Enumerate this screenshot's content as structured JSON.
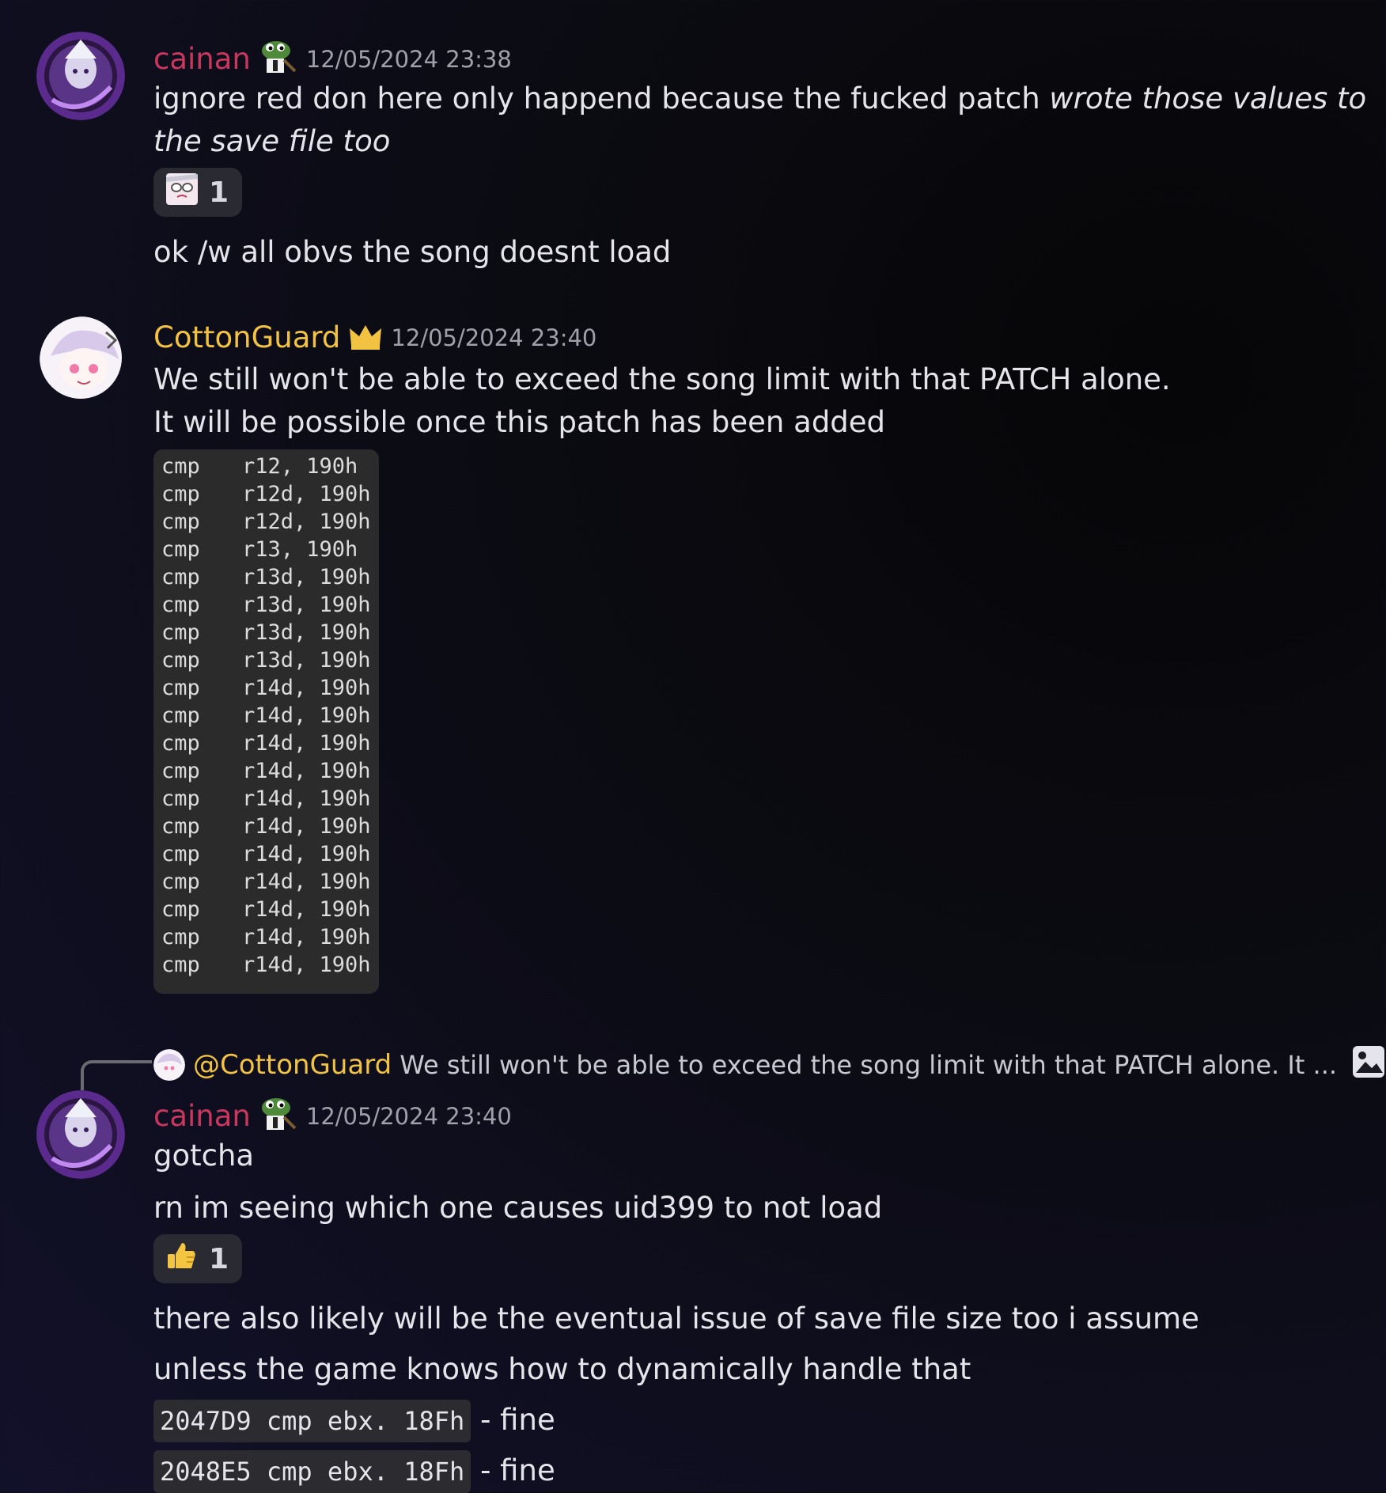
{
  "colors": {
    "cainan_name": "#c9375f",
    "cottonguard_name": "#f2c343",
    "timestamp": "#a0a0aa",
    "text": "#e4e4ea"
  },
  "messages": [
    {
      "author": "cainan",
      "badge_icon": "frog-badge-icon",
      "timestamp": "12/05/2024 23:38",
      "line1_a": "ignore red don here only happend because the fucked patch ",
      "line1_b": "wrote those values to",
      "line2": "the save file too",
      "reaction": {
        "emoji": "anime-face-emoji-icon",
        "count": "1"
      },
      "followup": "ok /w all obvs the song doesnt load"
    },
    {
      "author": "CottonGuard",
      "badge_icon": "crown-icon",
      "timestamp": "12/05/2024 23:40",
      "line1": "We still won't be able to exceed the song limit with that PATCH alone.",
      "line2": "It will be possible once this patch has been added",
      "code_image": {
        "rows": [
          {
            "op": "cmp",
            "arg": "r12, 190h"
          },
          {
            "op": "cmp",
            "arg": "r12d, 190h"
          },
          {
            "op": "cmp",
            "arg": "r12d, 190h"
          },
          {
            "op": "cmp",
            "arg": "r13, 190h"
          },
          {
            "op": "cmp",
            "arg": "r13d, 190h"
          },
          {
            "op": "cmp",
            "arg": "r13d, 190h"
          },
          {
            "op": "cmp",
            "arg": "r13d, 190h"
          },
          {
            "op": "cmp",
            "arg": "r13d, 190h"
          },
          {
            "op": "cmp",
            "arg": "r14d, 190h"
          },
          {
            "op": "cmp",
            "arg": "r14d, 190h"
          },
          {
            "op": "cmp",
            "arg": "r14d, 190h"
          },
          {
            "op": "cmp",
            "arg": "r14d, 190h"
          },
          {
            "op": "cmp",
            "arg": "r14d, 190h"
          },
          {
            "op": "cmp",
            "arg": "r14d, 190h"
          },
          {
            "op": "cmp",
            "arg": "r14d, 190h"
          },
          {
            "op": "cmp",
            "arg": "r14d, 190h"
          },
          {
            "op": "cmp",
            "arg": "r14d, 190h"
          },
          {
            "op": "cmp",
            "arg": "r14d, 190h"
          },
          {
            "op": "cmp",
            "arg": "r14d, 190h"
          }
        ]
      }
    },
    {
      "reply_to": {
        "mention": "@CottonGuard",
        "snippet": "We still won't be able to exceed the song limit with that PATCH alone. It ..."
      },
      "author": "cainan",
      "badge_icon": "frog-badge-icon",
      "timestamp": "12/05/2024 23:40",
      "line1": "gotcha",
      "line2": "rn im seeing which one causes uid399 to not load",
      "reaction": {
        "emoji": "thumbs-up-emoji-icon",
        "count": "1"
      },
      "line3": "there also likely will be the eventual issue of save file size too i assume",
      "line4": "unless the game knows how to dynamically handle that",
      "code1": "2047D9 cmp ebx. 18Fh",
      "code1_suffix": " - fine",
      "code2": "2048E5 cmp ebx. 18Fh",
      "code2_suffix": " - fine"
    }
  ]
}
